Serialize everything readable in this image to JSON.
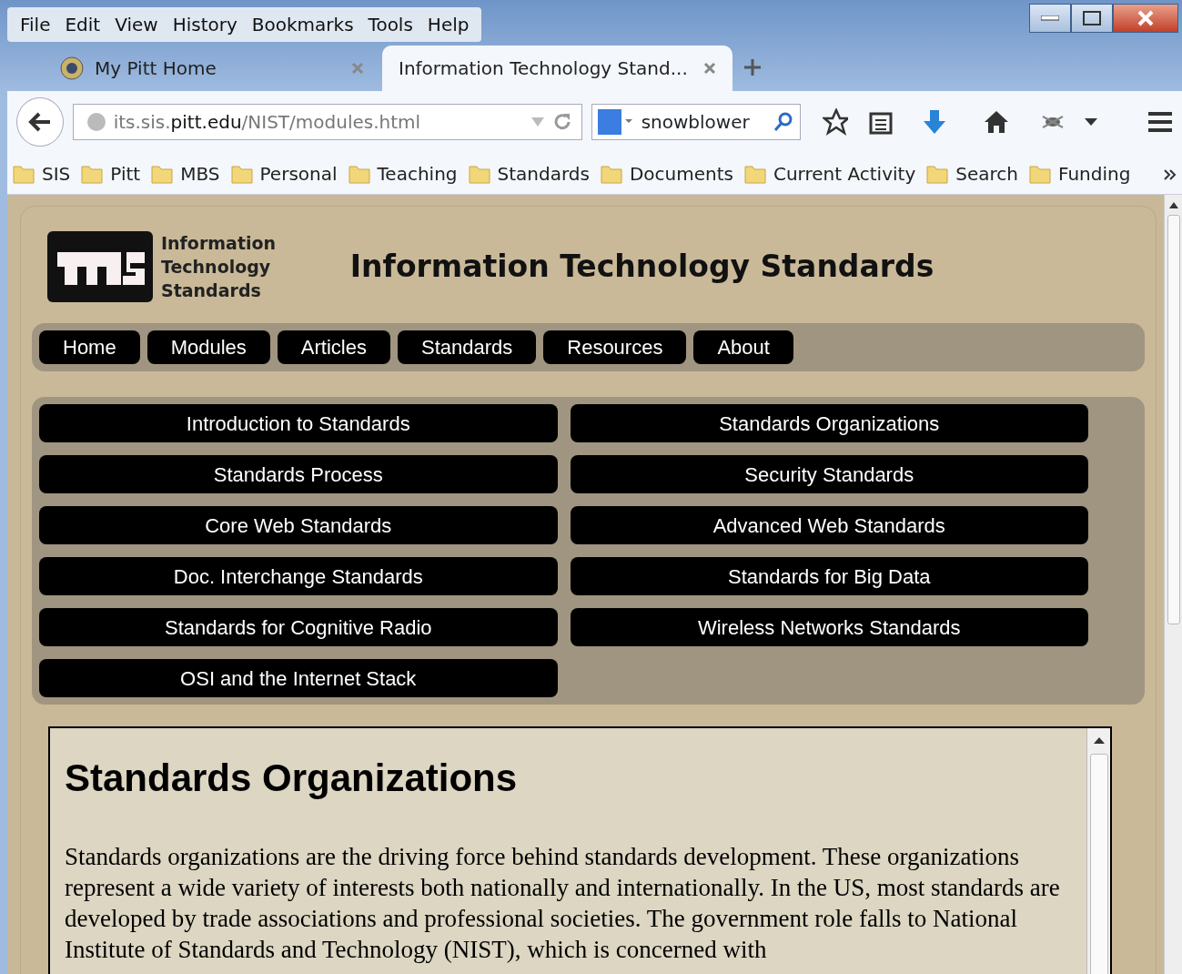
{
  "menu_bar": [
    "File",
    "Edit",
    "View",
    "History",
    "Bookmarks",
    "Tools",
    "Help"
  ],
  "tabs": [
    {
      "label": "My Pitt Home",
      "selected": false
    },
    {
      "label": "Information Technology Stand...",
      "selected": true
    }
  ],
  "address_bar": {
    "host_prefix": "its.sis.",
    "host": "pitt.edu",
    "path": "/NIST/modules.html"
  },
  "search_box": {
    "value": "snowblower"
  },
  "bookmarks": [
    "SIS",
    "Pitt",
    "MBS",
    "Personal",
    "Teaching",
    "Standards",
    "Documents",
    "Current Activity",
    "Search",
    "Funding"
  ],
  "site": {
    "logo_text": [
      "Information",
      "Technology",
      "Standards"
    ],
    "title": "Information Technology Standards",
    "nav": [
      "Home",
      "Modules",
      "Articles",
      "Standards",
      "Resources",
      "About"
    ],
    "modules": [
      "Introduction to Standards",
      "Standards Organizations",
      "Standards Process",
      "Security Standards",
      "Core Web Standards",
      "Advanced Web Standards",
      "Doc. Interchange Standards",
      "Standards for Big Data",
      "Standards for Cognitive Radio",
      "Wireless Networks Standards",
      "OSI and the Internet Stack"
    ],
    "article": {
      "heading": "Standards Organizations",
      "paragraph": "Standards organizations are the driving force behind standards development. These organizations represent a wide variety of interests both nationally and internationally. In the US, most standards are developed by trade associations and professional societies. The government role falls to National Institute of Standards and Technology (NIST), which is concerned with"
    }
  }
}
